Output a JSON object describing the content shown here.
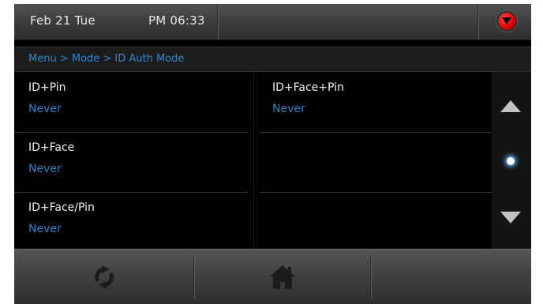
{
  "header": {
    "date": "Feb 21 Tue",
    "time": "PM 06:33",
    "power_icon": "power-triangle-icon",
    "power_color": "#d40000"
  },
  "breadcrumb": {
    "text": "Menu > Mode > ID Auth Mode"
  },
  "modes": [
    {
      "label": "ID+Pin",
      "value": "Never"
    },
    {
      "label": "ID+Face",
      "value": "Never"
    },
    {
      "label": "ID+Face/Pin",
      "value": "Never"
    },
    {
      "label": "ID+Face+Pin",
      "value": "Never"
    }
  ],
  "scroll": {
    "up_icon": "triangle-up-icon",
    "down_icon": "triangle-down-icon",
    "page_indicator_icon": "page-dot-icon"
  },
  "footer": {
    "buttons": [
      {
        "icon": "refresh-icon"
      },
      {
        "icon": "home-icon"
      },
      {
        "icon": ""
      }
    ]
  },
  "colors": {
    "accent_blue": "#2d7fc4",
    "background": "#000000",
    "text": "#f0f0f0"
  }
}
